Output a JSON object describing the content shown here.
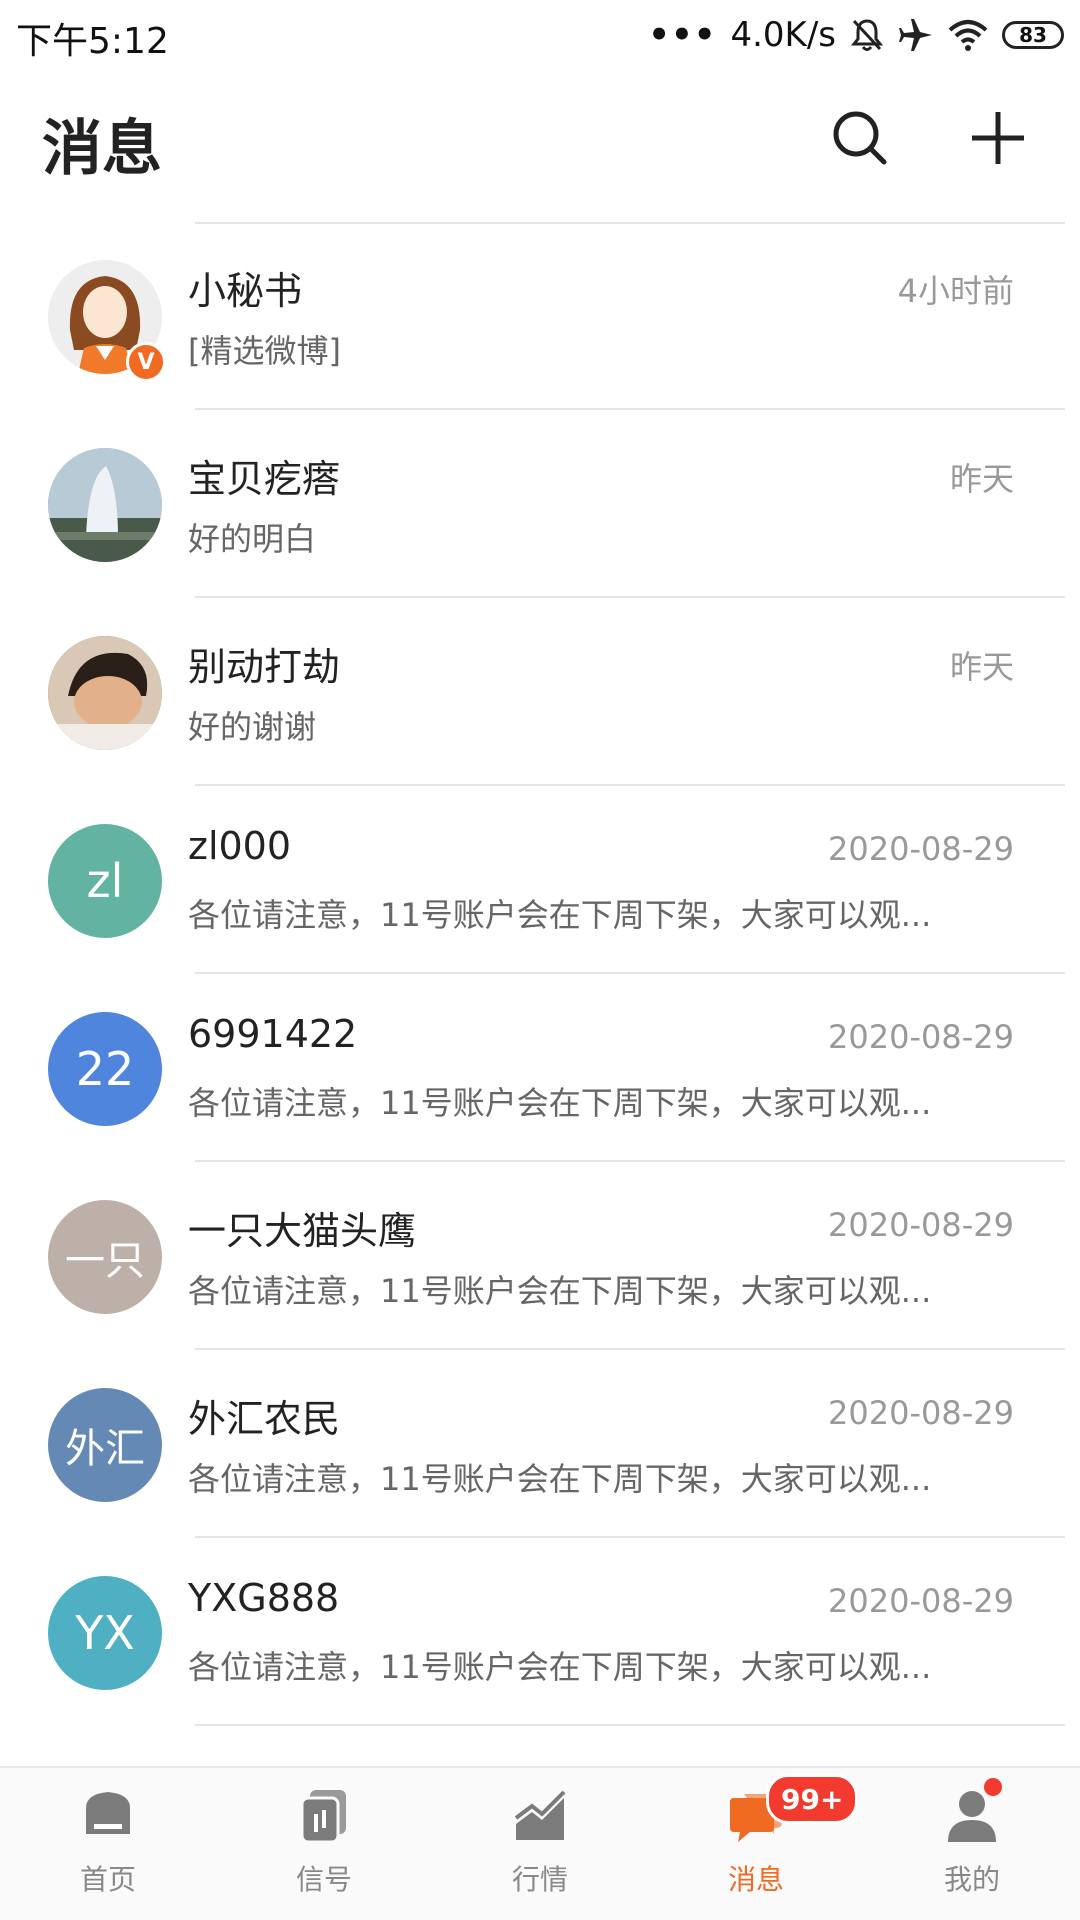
{
  "status_bar": {
    "time": "下午5:12",
    "dots": "•••",
    "speed": "4.0K/s",
    "battery": "83"
  },
  "header": {
    "title": "消息"
  },
  "conversations": [
    {
      "name": "小秘书",
      "time": "4小时前",
      "preview": "[精选微博]",
      "avatar_text": "",
      "avatar_color": "#f2e6dc",
      "badge": "V"
    },
    {
      "name": "宝贝疙瘩",
      "time": "昨天",
      "preview": "好的明白",
      "avatar_text": "",
      "avatar_color": "#9fb7c9"
    },
    {
      "name": "别动打劫",
      "time": "昨天",
      "preview": "好的谢谢",
      "avatar_text": "",
      "avatar_color": "#8a6a52"
    },
    {
      "name": "zl000",
      "time": "2020-08-29",
      "preview": "各位请注意，11号账户会在下周下架，大家可以观...",
      "avatar_text": "zl",
      "avatar_color": "#62b3a1"
    },
    {
      "name": "6991422",
      "time": "2020-08-29",
      "preview": "各位请注意，11号账户会在下周下架，大家可以观...",
      "avatar_text": "22",
      "avatar_color": "#4f85dc"
    },
    {
      "name": "一只大猫头鹰",
      "time": "2020-08-29",
      "preview": "各位请注意，11号账户会在下周下架，大家可以观...",
      "avatar_text": "一只",
      "avatar_color": "#bcb0a8"
    },
    {
      "name": "外汇农民",
      "time": "2020-08-29",
      "preview": "各位请注意，11号账户会在下周下架，大家可以观...",
      "avatar_text": "外汇",
      "avatar_color": "#6489b5"
    },
    {
      "name": "YXG888",
      "time": "2020-08-29",
      "preview": "各位请注意，11号账户会在下周下架，大家可以观...",
      "avatar_text": "YX",
      "avatar_color": "#4eb0c2"
    }
  ],
  "tabbar": {
    "home": "首页",
    "signal": "信号",
    "market": "行情",
    "messages": "消息",
    "messages_badge": "99+",
    "mine": "我的",
    "accent_color": "#f06a22"
  }
}
